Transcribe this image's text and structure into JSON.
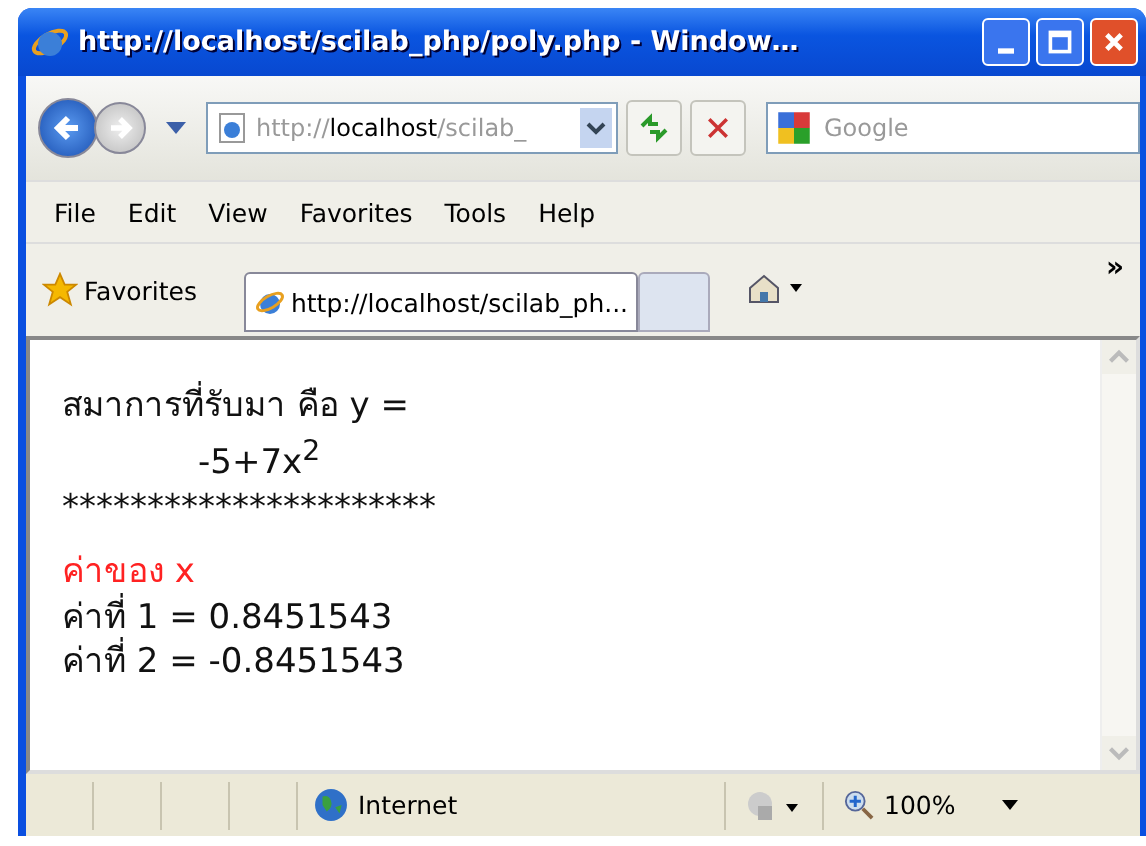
{
  "window": {
    "title": "http://localhost/scilab_php/poly.php - Window…"
  },
  "address_bar": {
    "prefix": "http://",
    "host": "localhost",
    "rest": "/scilab_"
  },
  "search": {
    "placeholder": "Google"
  },
  "menu": [
    "File",
    "Edit",
    "View",
    "Favorites",
    "Tools",
    "Help"
  ],
  "favorites_bar": {
    "label": "Favorites",
    "tabs": [
      {
        "label": "http://localhost/scilab_ph...",
        "selected": true
      },
      {
        "selected": false
      }
    ],
    "chevron": "»"
  },
  "content": {
    "lines": [
      {
        "kind": "text",
        "text": "สมาการที่รับมา คือ y ="
      },
      {
        "kind": "formula",
        "text": "-5+7x$^{2}$"
      },
      {
        "kind": "text",
        "text": "**********************"
      },
      {
        "kind": "heading",
        "text": "ค่าของ x"
      },
      {
        "kind": "text",
        "text": "ค่าที่ 1 = 0.8451543"
      },
      {
        "kind": "text",
        "text": "ค่าที่ 2 = -0.8451543"
      }
    ]
  },
  "status_bar": {
    "zone": "Internet",
    "zoom": "100%"
  }
}
